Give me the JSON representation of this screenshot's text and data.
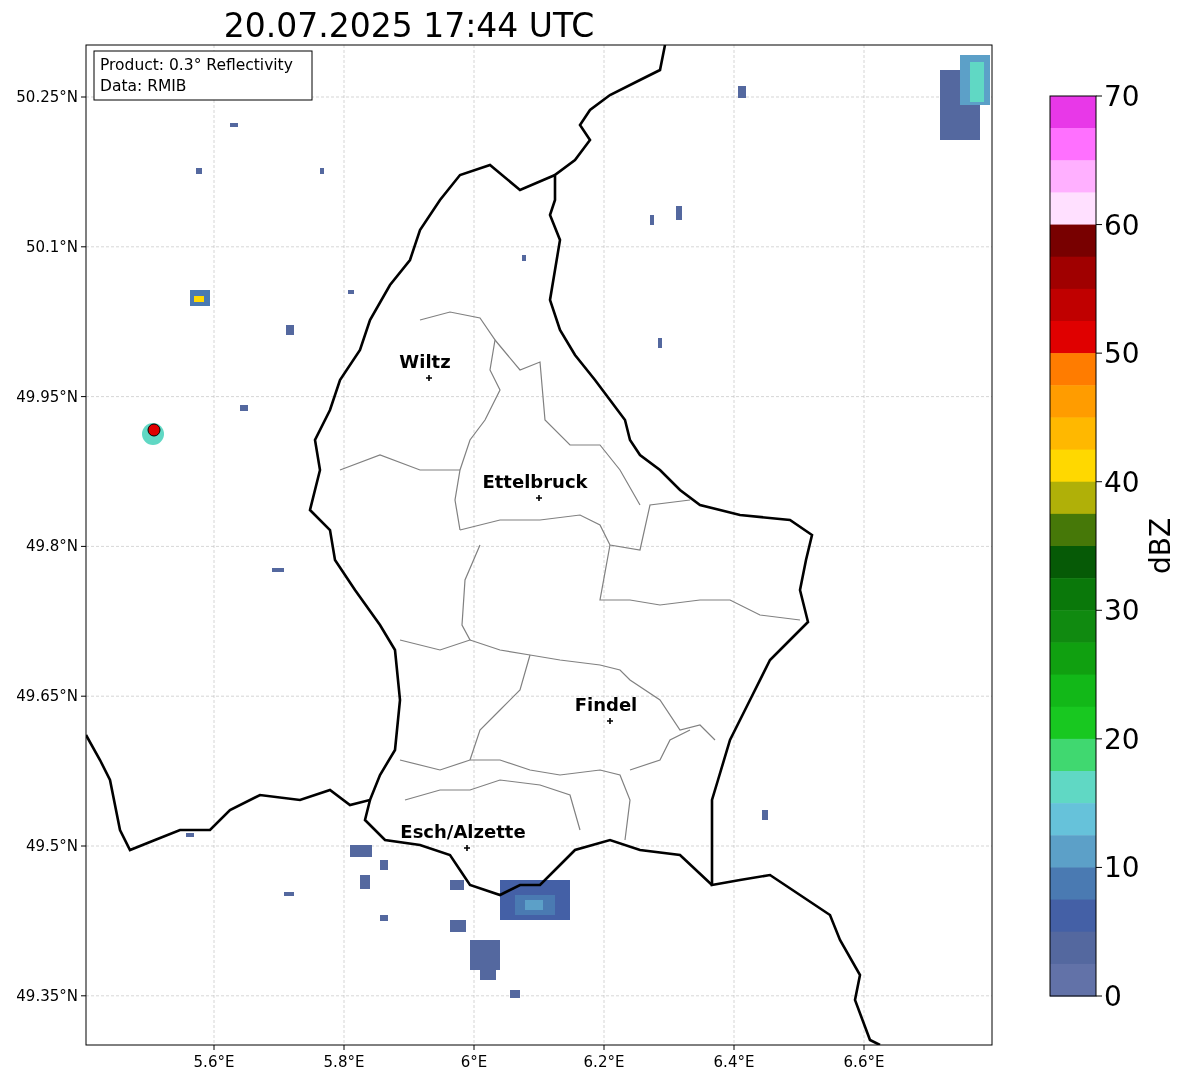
{
  "title": "20.07.2025 17:44 UTC",
  "legend": [
    "Product: 0.3° Reflectivity",
    "Data: RMIB"
  ],
  "map": {
    "x_tick_labels": [
      "5.6°E",
      "5.8°E",
      "6°E",
      "6.2°E",
      "6.4°E",
      "6.6°E"
    ],
    "y_tick_labels": [
      "50.25°N",
      "50.1°N",
      "49.95°N",
      "49.8°N",
      "49.65°N",
      "49.5°N",
      "49.35°N"
    ],
    "cities": [
      {
        "name": "Wiltz"
      },
      {
        "name": "Ettelbruck"
      },
      {
        "name": "Findel"
      },
      {
        "name": "Esch/Alzette"
      }
    ]
  },
  "colorbar": {
    "label": "dBZ",
    "ticks": [
      "70",
      "60",
      "50",
      "40",
      "30",
      "20",
      "10",
      "0"
    ],
    "bins": [
      {
        "color": "#e838e8"
      },
      {
        "color": "#ff70ff"
      },
      {
        "color": "#ffb0ff"
      },
      {
        "color": "#ffe0ff"
      },
      {
        "color": "#780000"
      },
      {
        "color": "#a00000"
      },
      {
        "color": "#c00000"
      },
      {
        "color": "#e00000"
      },
      {
        "color": "#ff7c00"
      },
      {
        "color": "#ff9c00"
      },
      {
        "color": "#ffb800"
      },
      {
        "color": "#ffd800"
      },
      {
        "color": "#b0b008"
      },
      {
        "color": "#467808"
      },
      {
        "color": "#065a06"
      },
      {
        "color": "#0a780a"
      },
      {
        "color": "#108a10"
      },
      {
        "color": "#10a010"
      },
      {
        "color": "#12b818"
      },
      {
        "color": "#18c820"
      },
      {
        "color": "#40d870"
      },
      {
        "color": "#60d8c4"
      },
      {
        "color": "#66c2da"
      },
      {
        "color": "#5ca0c8"
      },
      {
        "color": "#4a7ab2"
      },
      {
        "color": "#4460a6"
      },
      {
        "color": "#54689f"
      },
      {
        "color": "#6272a8"
      }
    ]
  }
}
